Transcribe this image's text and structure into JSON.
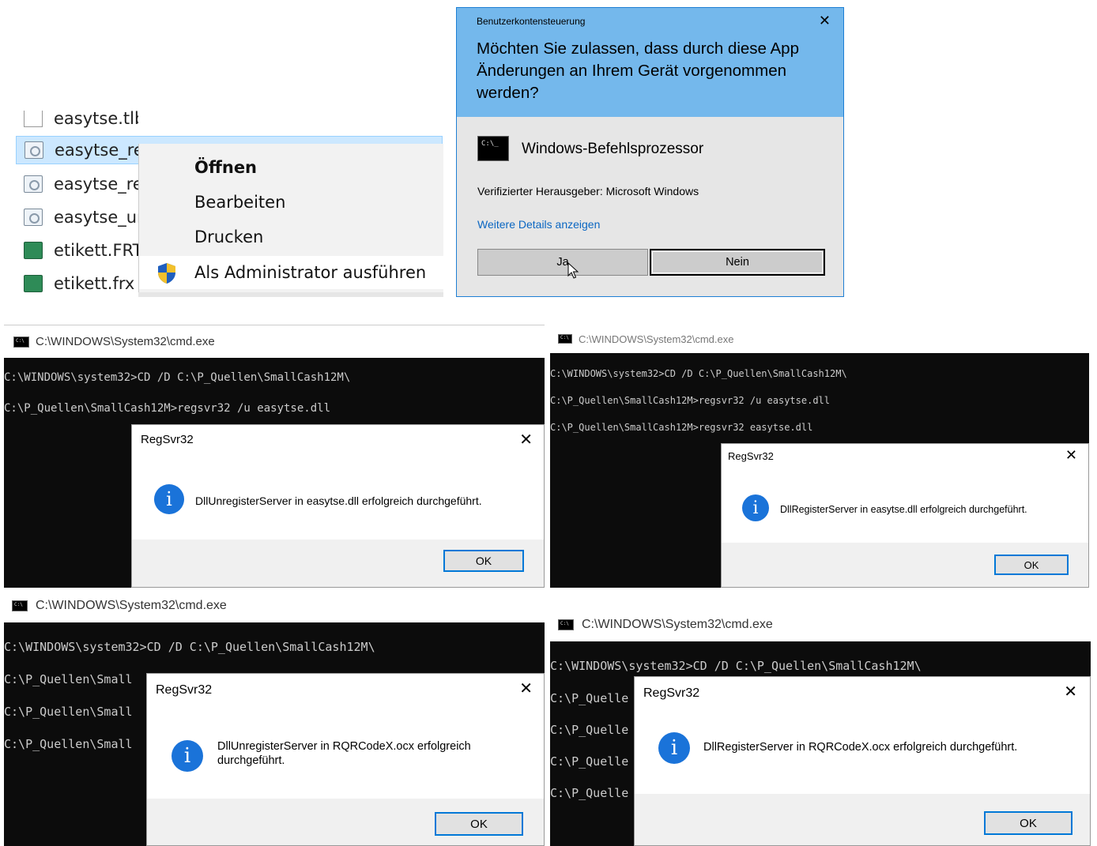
{
  "explorer": {
    "files": [
      {
        "name": "easytse.tlb",
        "icon": "file-icon"
      },
      {
        "name": "easytse_re",
        "icon": "config-file-icon"
      },
      {
        "name": "easytse_re",
        "icon": "config-file-icon"
      },
      {
        "name": "easytse_ur",
        "icon": "config-file-icon"
      },
      {
        "name": "etikett.FRT",
        "icon": "form-file-icon"
      },
      {
        "name": "etikett.frx",
        "icon": "form-file-icon"
      }
    ],
    "context_menu": {
      "items": [
        "Öffnen",
        "Bearbeiten",
        "Drucken",
        "Als Administrator ausführen"
      ]
    }
  },
  "uac": {
    "caption": "Benutzerkontensteuerung",
    "question": "Möchten Sie zulassen, dass durch diese App Änderungen an Ihrem Gerät vorgenommen werden?",
    "app_name": "Windows-Befehlsprozessor",
    "publisher": "Verifizierter Herausgeber: Microsoft Windows",
    "details_link": "Weitere Details anzeigen",
    "yes_label": "Ja",
    "no_label": "Nein"
  },
  "cmd_windows": [
    {
      "title": "C:\\WINDOWS\\System32\\cmd.exe",
      "lines": [
        "C:\\WINDOWS\\system32>CD /D C:\\P_Quellen\\SmallCash12M\\",
        "C:\\P_Quellen\\SmallCash12M>regsvr32 /u easytse.dll"
      ],
      "dialog": {
        "title": "RegSvr32",
        "message": "DllUnregisterServer in easytse.dll erfolgreich durchgeführt.",
        "ok": "OK"
      }
    },
    {
      "title": "C:\\WINDOWS\\System32\\cmd.exe",
      "lines": [
        "C:\\WINDOWS\\system32>CD /D C:\\P_Quellen\\SmallCash12M\\",
        "C:\\P_Quellen\\SmallCash12M>regsvr32 /u easytse.dll",
        "C:\\P_Quellen\\SmallCash12M>regsvr32 easytse.dll"
      ],
      "dialog": {
        "title": "RegSvr32",
        "message": "DllRegisterServer in easytse.dll erfolgreich durchgeführt.",
        "ok": "OK"
      }
    },
    {
      "title": "C:\\WINDOWS\\System32\\cmd.exe",
      "lines": [
        "C:\\WINDOWS\\system32>CD /D C:\\P_Quellen\\SmallCash12M\\",
        "C:\\P_Quellen\\Small",
        "C:\\P_Quellen\\Small",
        "C:\\P_Quellen\\Small"
      ],
      "dialog": {
        "title": "RegSvr32",
        "message": "DllUnregisterServer in RQRCodeX.ocx erfolgreich durchgeführt.",
        "ok": "OK"
      }
    },
    {
      "title": "C:\\WINDOWS\\System32\\cmd.exe",
      "lines": [
        "C:\\WINDOWS\\system32>CD /D C:\\P_Quellen\\SmallCash12M\\",
        "C:\\P_Quelle",
        "C:\\P_Quelle",
        "C:\\P_Quelle",
        "C:\\P_Quelle"
      ],
      "dialog": {
        "title": "RegSvr32",
        "message": "DllRegisterServer in RQRCodeX.ocx erfolgreich durchgeführt.",
        "ok": "OK"
      }
    }
  ],
  "colors": {
    "uac_header": "#74b8ec",
    "link": "#0a66c2",
    "console_bg": "#0c0c0c",
    "info_icon": "#1a73d9",
    "ok_border": "#0078d7"
  }
}
